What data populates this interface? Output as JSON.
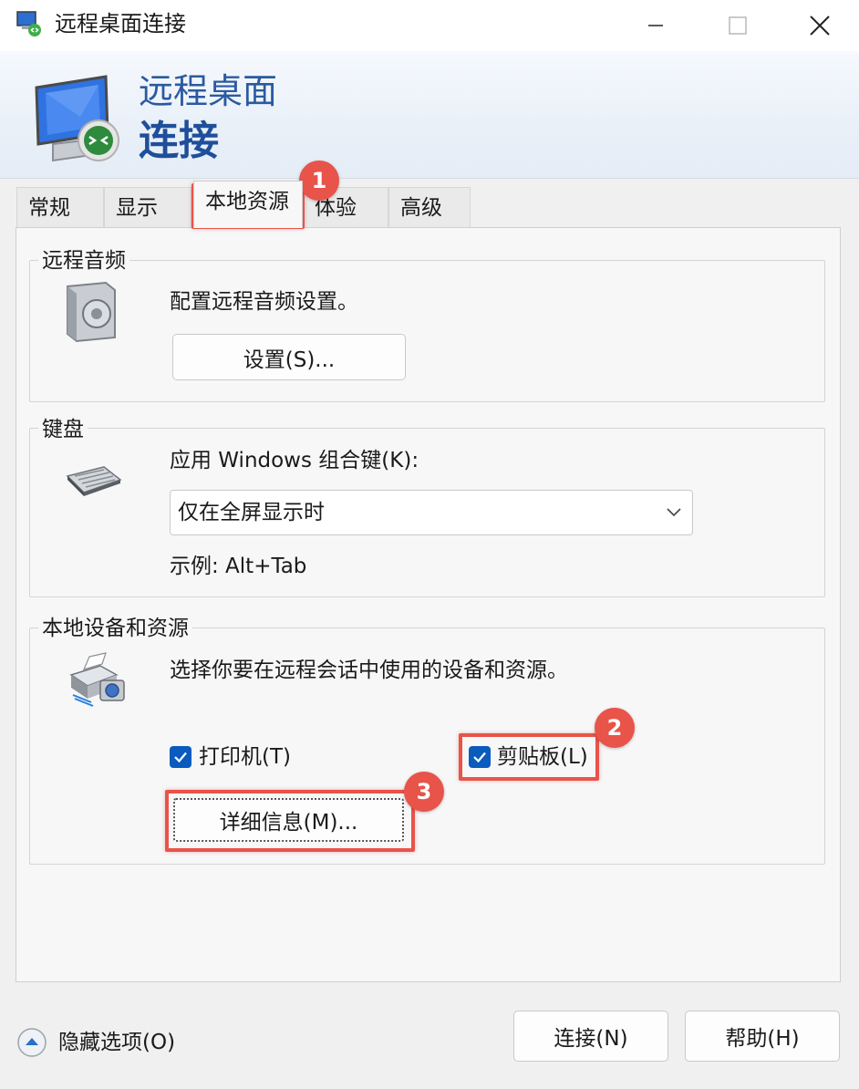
{
  "window": {
    "title": "远程桌面连接",
    "controls": {
      "minimize": "minimize-icon",
      "maximize": "maximize-icon",
      "close": "close-icon"
    }
  },
  "banner": {
    "line1": "远程桌面",
    "line2": "连接"
  },
  "tabs": [
    {
      "label": "常规",
      "selected": false
    },
    {
      "label": "显示",
      "selected": false
    },
    {
      "label": "本地资源",
      "selected": true
    },
    {
      "label": "体验",
      "selected": false
    },
    {
      "label": "高级",
      "selected": false
    }
  ],
  "remote_audio": {
    "group_label": "远程音频",
    "description": "配置远程音频设置。",
    "settings_button": "设置(S)..."
  },
  "keyboard": {
    "group_label": "键盘",
    "apply_label": "应用 Windows 组合键(K):",
    "combo_value": "仅在全屏显示时",
    "example": "示例: Alt+Tab"
  },
  "local_devices": {
    "group_label": "本地设备和资源",
    "description": "选择你要在远程会话中使用的设备和资源。",
    "printer_label": "打印机(T)",
    "printer_checked": true,
    "clipboard_label": "剪贴板(L)",
    "clipboard_checked": true,
    "more_button": "详细信息(M)..."
  },
  "footer": {
    "hide_options": "隐藏选项(O)",
    "connect": "连接(N)",
    "help": "帮助(H)"
  },
  "annotations": [
    "1",
    "2",
    "3"
  ],
  "colors": {
    "accent": "#0a5bbd",
    "annotation": "#e8534a",
    "banner_text": "#1f4f9a"
  }
}
